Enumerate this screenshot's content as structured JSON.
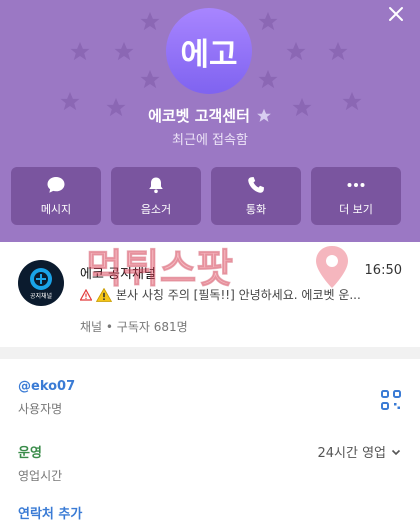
{
  "profile": {
    "avatar_text": "에고",
    "name": "에코벳 고객센터",
    "status": "최근에 접속함",
    "header_color": "#9b78c4"
  },
  "actions": [
    {
      "label": "메시지",
      "icon": "chat-icon"
    },
    {
      "label": "음소거",
      "icon": "bell-icon"
    },
    {
      "label": "통화",
      "icon": "phone-icon"
    },
    {
      "label": "더 보기",
      "icon": "more-icon"
    }
  ],
  "channel": {
    "title": "에코 공지채널",
    "time": "16:50",
    "preview": "본사 사칭 주의 [필독!!]  안녕하세요. 에코벳 운...",
    "meta": "채널 • 구독자 681명",
    "logo_text": "공지채널"
  },
  "watermark": "먹튀스팟",
  "info": {
    "username": "@eko07",
    "username_label": "사용자명",
    "operation": "운영",
    "operation_label": "영업시간",
    "hours": "24시간 영업",
    "add_contact": "연락처 추가"
  }
}
